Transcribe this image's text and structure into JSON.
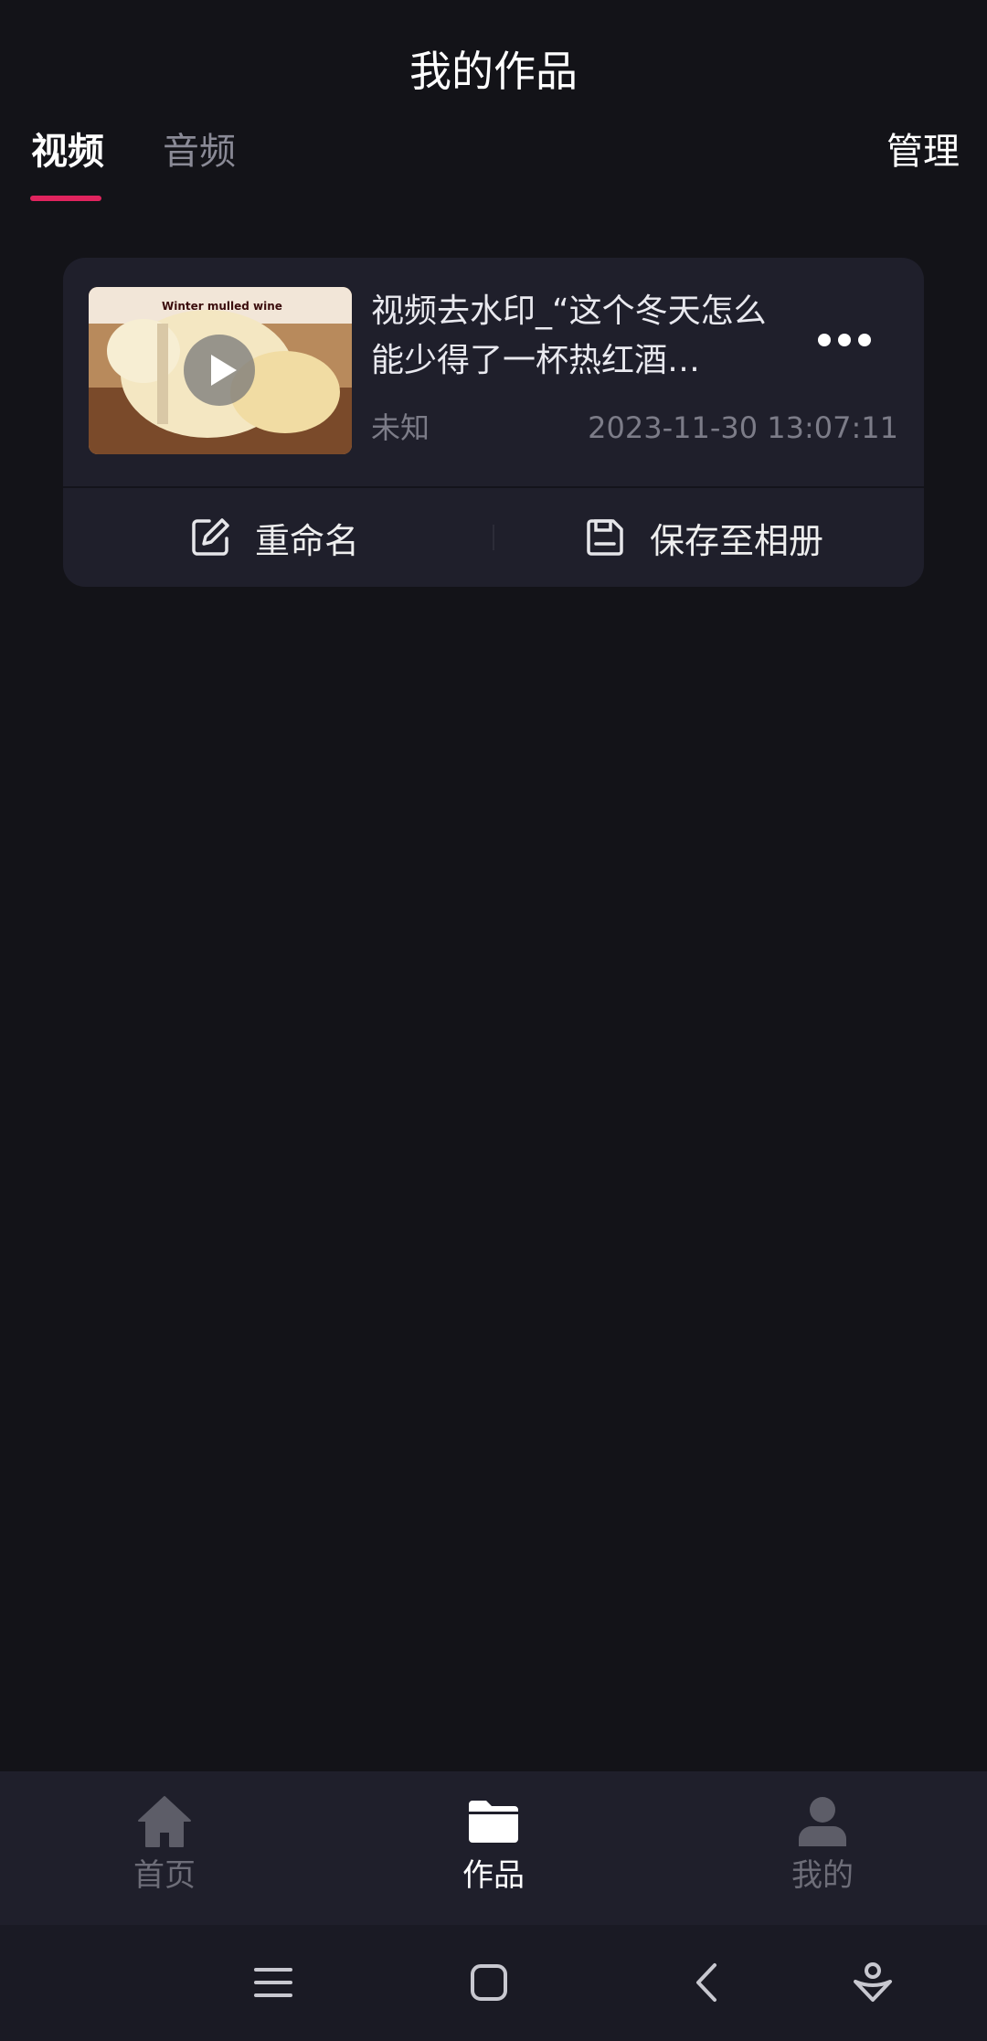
{
  "header": {
    "title": "我的作品",
    "manage_label": "管理"
  },
  "tabs": [
    {
      "label": "视频",
      "active": true
    },
    {
      "label": "音频",
      "active": false
    }
  ],
  "accent_color": "#e0245e",
  "works": [
    {
      "title": "视频去水印_“这个冬天怎么能少得了一杯热红酒…",
      "size": "未知",
      "date": "2023-11-30 13:07:11",
      "thumbnail_caption": "Winter mulled wine",
      "rename_label": "重命名",
      "save_label": "保存至相册"
    }
  ],
  "bottom_nav": [
    {
      "label": "首页",
      "icon": "home-icon",
      "active": false
    },
    {
      "label": "作品",
      "icon": "folder-icon",
      "active": true
    },
    {
      "label": "我的",
      "icon": "person-icon",
      "active": false
    }
  ],
  "system_nav": [
    "menu-icon",
    "home-square-icon",
    "back-icon",
    "assistant-icon"
  ]
}
